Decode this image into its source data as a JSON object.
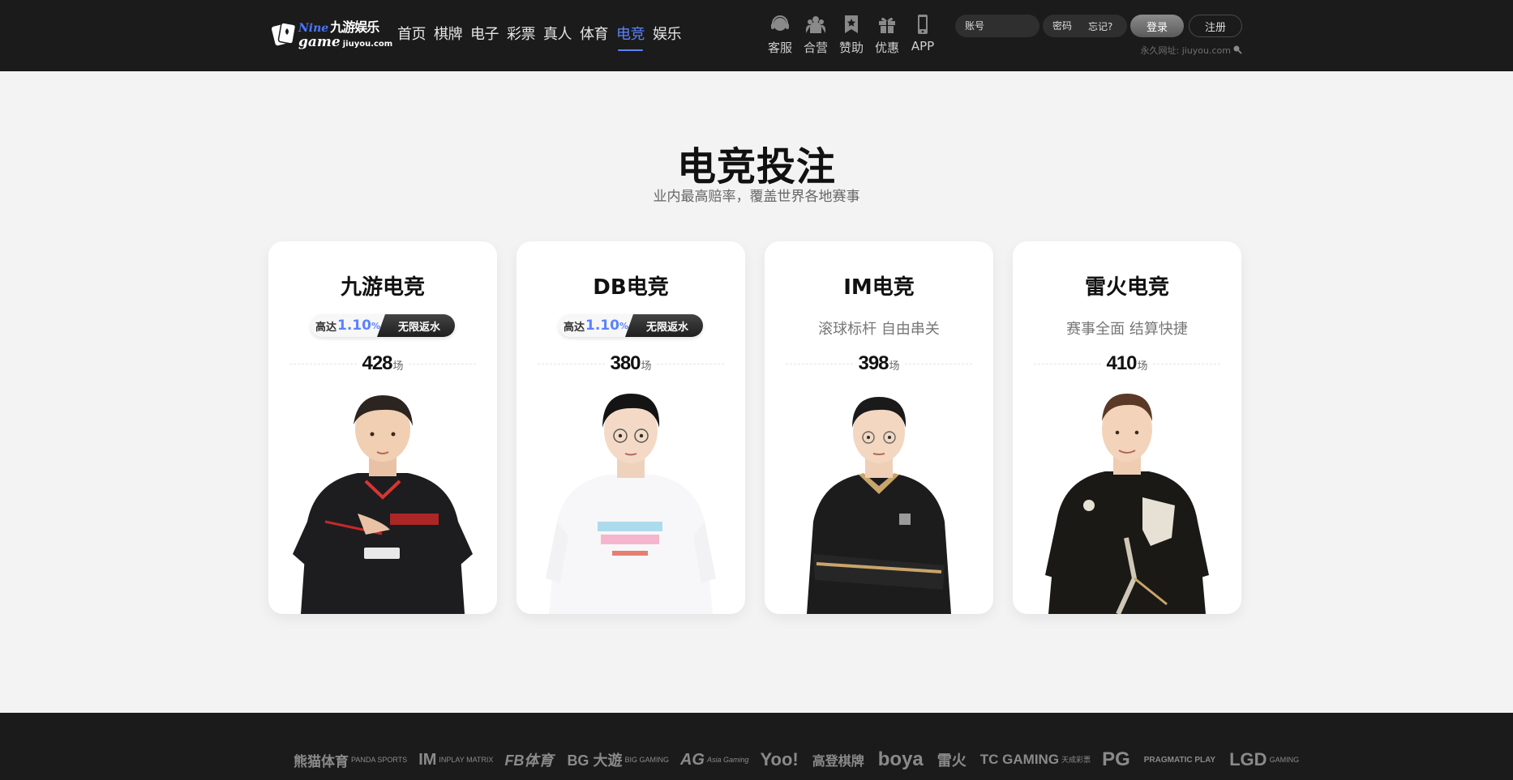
{
  "header": {
    "logo": {
      "nine": "Nine",
      "cn": "九游娱乐",
      "game": "game",
      "url": "jiuyou.com"
    },
    "nav": [
      "首页",
      "棋牌",
      "电子",
      "彩票",
      "真人",
      "体育",
      "电竞",
      "娱乐"
    ],
    "active_nav": "电竞",
    "quick": [
      {
        "label": "客服",
        "icon": "headset-icon"
      },
      {
        "label": "合营",
        "icon": "partners-icon"
      },
      {
        "label": "赞助",
        "icon": "sponsor-bookmark-icon"
      },
      {
        "label": "优惠",
        "icon": "gift-icon"
      },
      {
        "label": "APP",
        "icon": "mobile-phone-icon"
      }
    ],
    "login": {
      "account_placeholder": "账号",
      "password_placeholder": "密码",
      "forgot": "忘记?",
      "login_button": "登录",
      "register_button": "注册"
    },
    "permanent_url": "永久网址: jiuyou.com"
  },
  "section": {
    "title": "电竞投注",
    "subtitle": "业内最高赔率，覆盖世界各地赛事"
  },
  "cards": [
    {
      "title": "九游电竞",
      "badge": {
        "prefix": "高达",
        "value": "1.10",
        "unit": "%",
        "tag": "无限返水"
      },
      "count": "428",
      "count_unit": "场"
    },
    {
      "title": "DB电竞",
      "badge": {
        "prefix": "高达",
        "value": "1.10",
        "unit": "%",
        "tag": "无限返水"
      },
      "count": "380",
      "count_unit": "场"
    },
    {
      "title": "IM电竞",
      "subtitle": "滚球标杆 自由串关",
      "count": "398",
      "count_unit": "场"
    },
    {
      "title": "雷火电竞",
      "subtitle": "赛事全面 结算快捷",
      "count": "410",
      "count_unit": "场"
    }
  ],
  "footer": {
    "partners": [
      {
        "name": "熊猫体育",
        "small": "PANDA SPORTS"
      },
      {
        "name": "IM",
        "small": "INPLAY MATRIX"
      },
      {
        "name": "FB体育",
        "small": ""
      },
      {
        "name": "BG 大遊",
        "small": "BIG GAMING"
      },
      {
        "name": "AG",
        "small": "Asia Gaming"
      },
      {
        "name": "Yoo!",
        "small": ""
      },
      {
        "name": "高登棋牌",
        "small": ""
      },
      {
        "name": "boya",
        "small": ""
      },
      {
        "name": "雷火",
        "small": ""
      },
      {
        "name": "TC GAMING",
        "small": "天成彩票"
      },
      {
        "name": "PG",
        "small": ""
      },
      {
        "name": "PRAGMATIC PLAY",
        "small": ""
      },
      {
        "name": "LGD",
        "small": "GAMING"
      }
    ]
  }
}
